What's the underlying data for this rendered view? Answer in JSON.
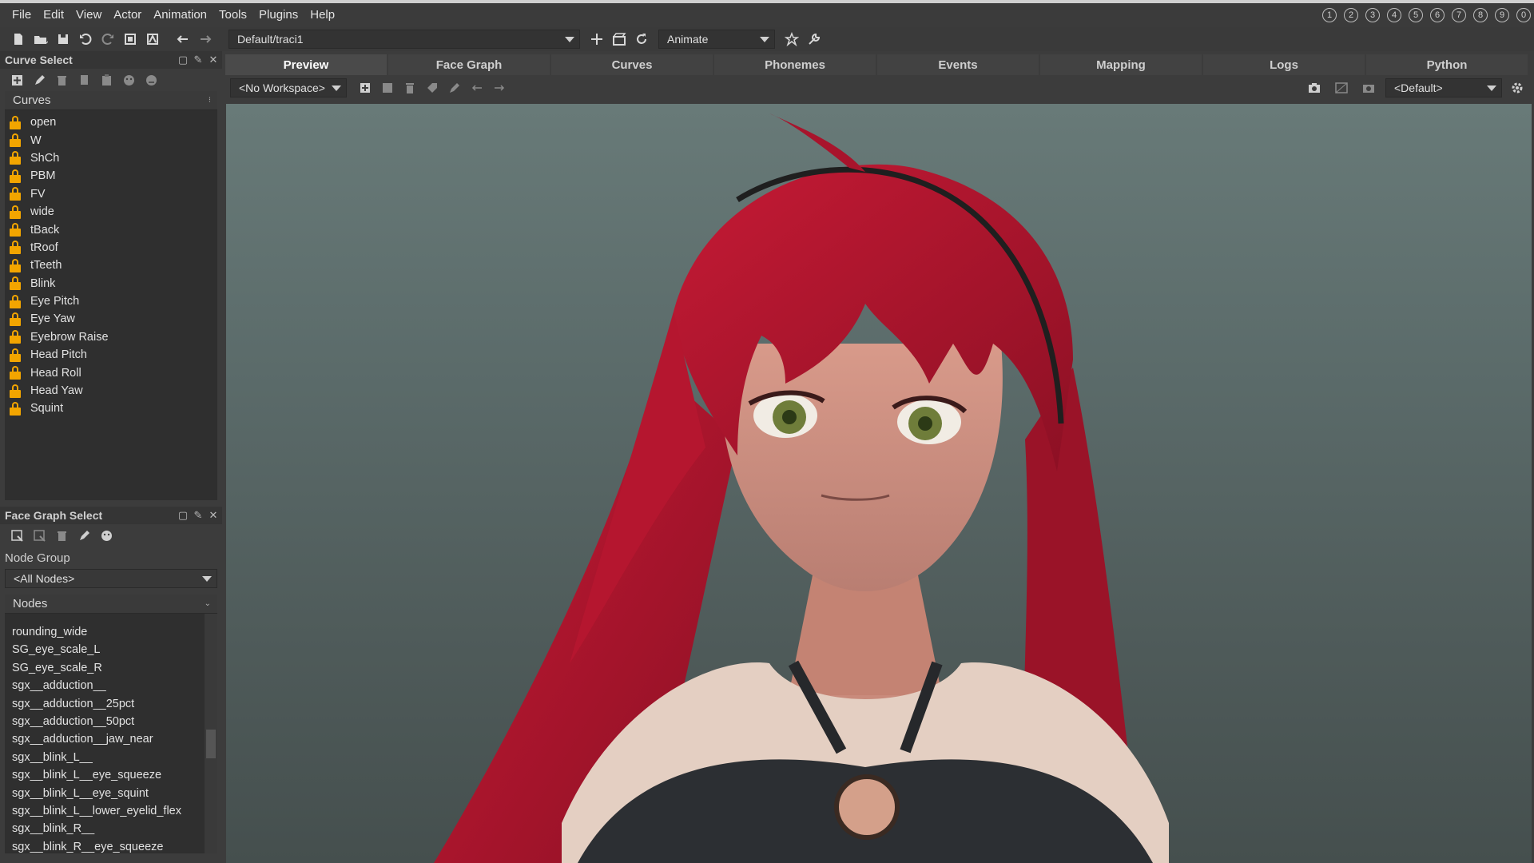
{
  "menu": [
    "File",
    "Edit",
    "View",
    "Actor",
    "Animation",
    "Tools",
    "Plugins",
    "Help"
  ],
  "slots": [
    "1",
    "2",
    "3",
    "4",
    "5",
    "6",
    "7",
    "8",
    "9",
    "0"
  ],
  "toolbar": {
    "path": "Default/traci1",
    "mode": "Animate"
  },
  "curve_select": {
    "title": "Curve Select",
    "list_header": "Curves",
    "items": [
      "open",
      "W",
      "ShCh",
      "PBM",
      "FV",
      "wide",
      "tBack",
      "tRoof",
      "tTeeth",
      "Blink",
      "Eye Pitch",
      "Eye Yaw",
      "Eyebrow Raise",
      "Head Pitch",
      "Head Roll",
      "Head Yaw",
      "Squint"
    ]
  },
  "face_graph_select": {
    "title": "Face Graph Select",
    "node_group_label": "Node Group",
    "node_group_value": "<All Nodes>",
    "nodes_header": "Nodes",
    "nodes": [
      "rounding_wide",
      "SG_eye_scale_L",
      "SG_eye_scale_R",
      "sgx__adduction__",
      "sgx__adduction__25pct",
      "sgx__adduction__50pct",
      "sgx__adduction__jaw_near",
      "sgx__blink_L__",
      "sgx__blink_L__eye_squeeze",
      "sgx__blink_L__eye_squint",
      "sgx__blink_L__lower_eyelid_flex",
      "sgx__blink_R__",
      "sgx__blink_R__eye_squeeze"
    ]
  },
  "tabs": [
    "Preview",
    "Face Graph",
    "Curves",
    "Phonemes",
    "Events",
    "Mapping",
    "Logs",
    "Python"
  ],
  "active_tab": "Preview",
  "viewport_toolbar": {
    "workspace": "<No Workspace>",
    "camera": "<Default>"
  },
  "colors": {
    "lock": "#f2a500",
    "hair": "#b5162f",
    "background": "#3c3c3c"
  }
}
